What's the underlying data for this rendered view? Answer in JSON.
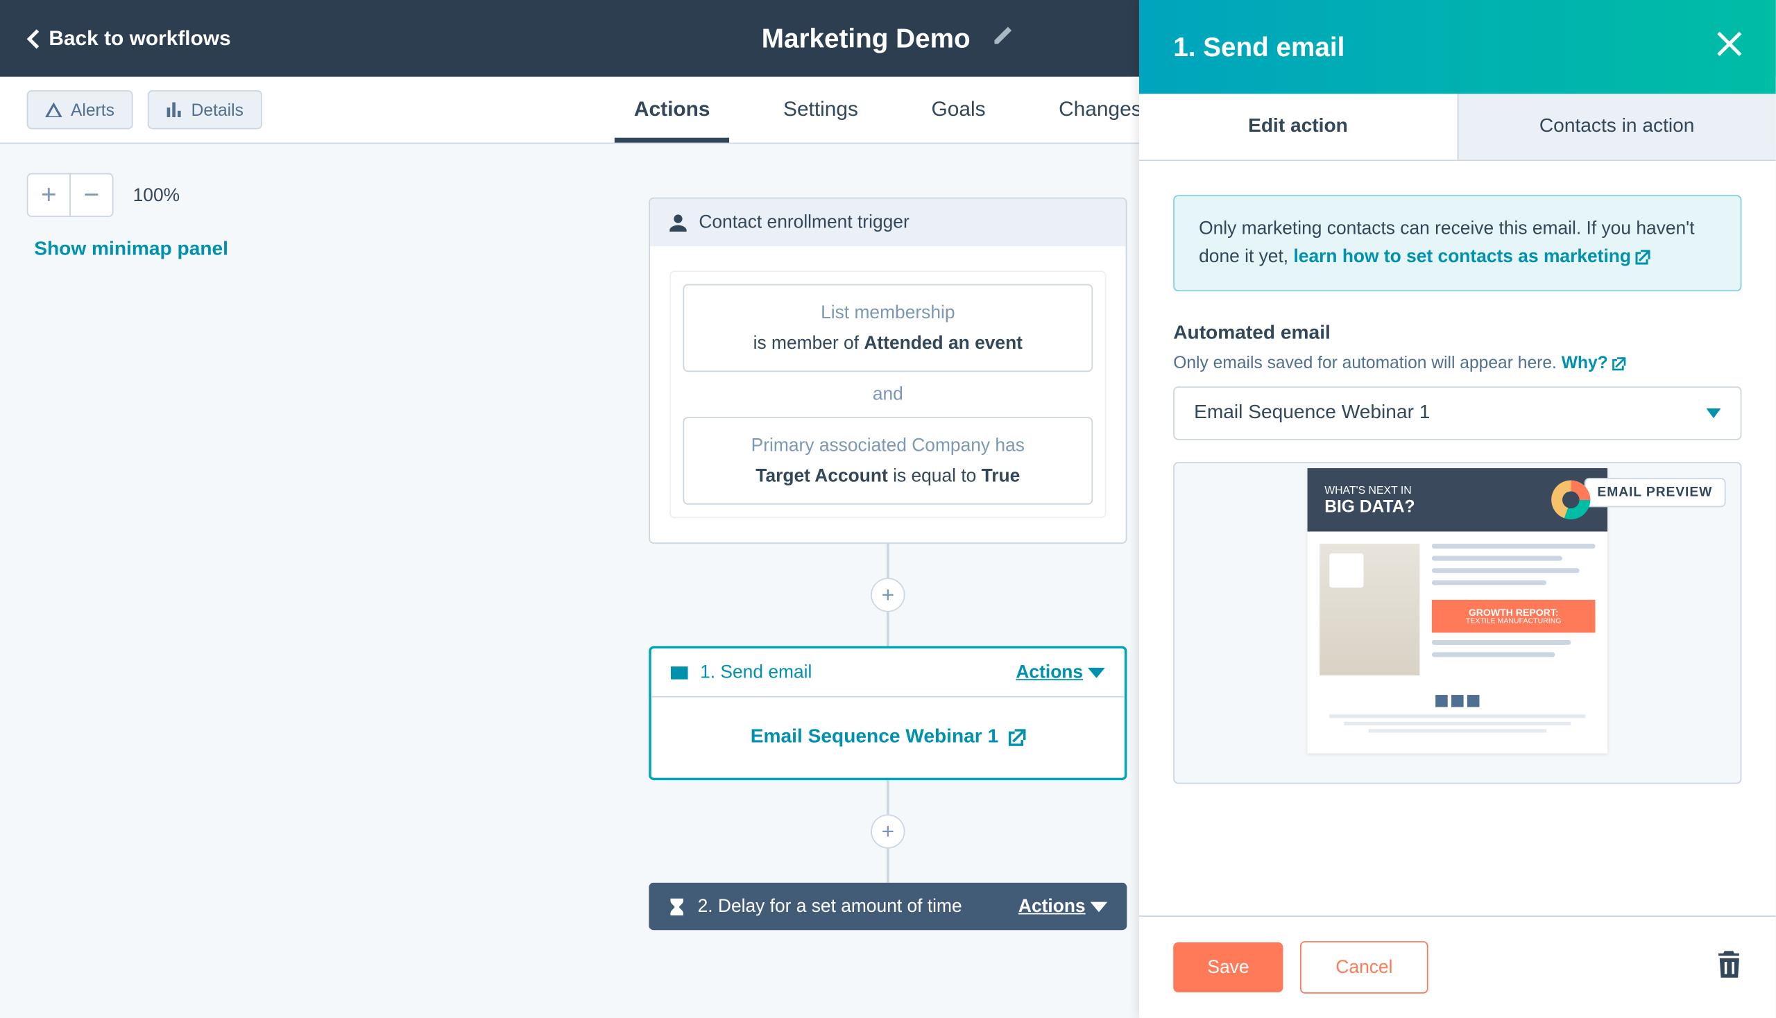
{
  "header": {
    "back": "Back to workflows",
    "title": "Marketing Demo"
  },
  "toolbar": {
    "alerts": "Alerts",
    "details": "Details",
    "tabs": [
      "Actions",
      "Settings",
      "Goals",
      "Changes"
    ]
  },
  "canvas": {
    "zoom": "100%",
    "minimap": "Show minimap panel"
  },
  "flow": {
    "trigger_header": "Contact enrollment trigger",
    "trigger1_label": "List membership",
    "trigger1_prefix": "is member of ",
    "trigger1_bold": "Attended an event",
    "and": "and",
    "trigger2_label": "Primary associated Company has",
    "trigger2_b1": "Target Account",
    "trigger2_mid": " is equal to ",
    "trigger2_b2": "True",
    "step1_title": "1. Send email",
    "step1_actions": "Actions",
    "step1_email": "Email Sequence Webinar 1",
    "step2_title": "2. Delay for a set amount of time",
    "step2_actions": "Actions"
  },
  "panel": {
    "title": "1. Send email",
    "tab_edit": "Edit action",
    "tab_contacts": "Contacts in action",
    "info_text": "Only marketing contacts can receive this email. If you haven't done it yet, ",
    "info_link": "learn how to set contacts as marketing",
    "section_label": "Automated email",
    "section_help": "Only emails saved for automation will appear here. ",
    "why": "Why?",
    "select_value": "Email Sequence Webinar 1",
    "preview_badge": "EMAIL PREVIEW",
    "mock_t1": "WHAT'S NEXT IN",
    "mock_t2": "BIG DATA?",
    "mock_cta1": "GROWTH REPORT:",
    "mock_cta2": "TEXTILE MANUFACTURING",
    "save": "Save",
    "cancel": "Cancel"
  }
}
